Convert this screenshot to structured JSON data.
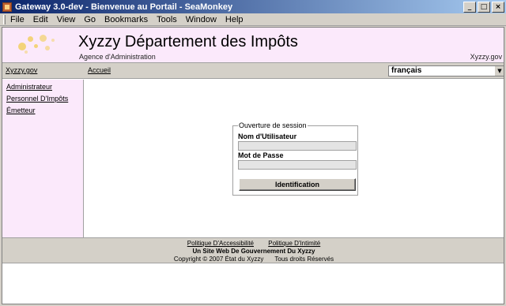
{
  "window": {
    "title": "Gateway 3.0-dev - Bienvenue au Portail - SeaMonkey",
    "minimize": "_",
    "maximize": "□",
    "close": "×"
  },
  "menubar": [
    "File",
    "Edit",
    "View",
    "Go",
    "Bookmarks",
    "Tools",
    "Window",
    "Help"
  ],
  "banner": {
    "title": "Xyzzy Département des Impôts",
    "subtitle": "Agence d'Administration",
    "domain": "Xyzzy.gov"
  },
  "nav": {
    "home_domain": "Xyzzy.gov",
    "home": "Accueil",
    "language": "français"
  },
  "sidebar": {
    "items": [
      "Administrateur",
      "Personnel D'Impôts",
      "Émetteur"
    ]
  },
  "login": {
    "legend": "Ouverture de session",
    "username_label": "Nom d'Utilisateur",
    "username_value": "",
    "password_label": "Mot de Passe",
    "password_value": "",
    "submit": "Identification"
  },
  "footer": {
    "accessibility": "Politique D'Accessibilité",
    "privacy": "Politique D'Intimité",
    "tagline": "Un Site Web De Gouvernement Du Xyzzy",
    "copyright": "Copyright © 2007 État du Xyzzy",
    "rights": "Tous droits Réservés"
  },
  "colors": {
    "banner_bg": "#fbe9fb",
    "chrome": "#d4d0c8",
    "titlebar": "#0a246a"
  }
}
